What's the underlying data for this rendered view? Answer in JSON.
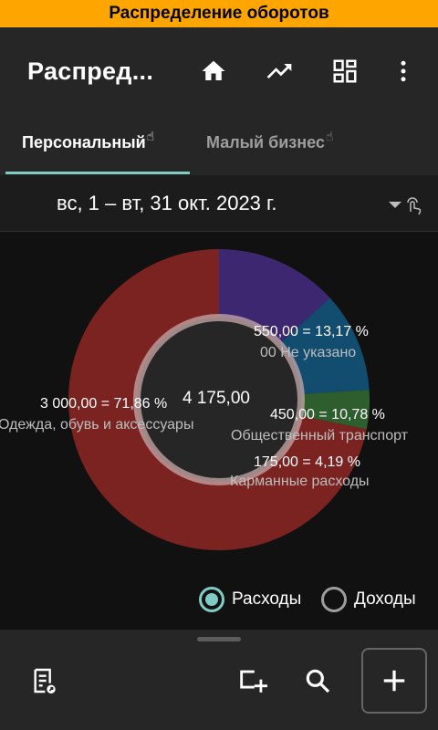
{
  "banner": {
    "title": "Распределение оборотов"
  },
  "appbar": {
    "title": "Распред...",
    "icons": [
      "home-icon",
      "trending-up-icon",
      "dashboard-icon",
      "more-vert-icon"
    ]
  },
  "tabs": [
    {
      "label": "Персональный",
      "selected": true,
      "sup": "☝"
    },
    {
      "label": "Малый бизнес",
      "selected": false,
      "sup": "☝"
    }
  ],
  "period": {
    "label": "вс, 1 – вт, 31 окт. 2023 г."
  },
  "chart_data": {
    "type": "pie",
    "donut": true,
    "total": "4 175,00",
    "slices": [
      {
        "name": "Одежда, обувь и аксессуары",
        "value": 3000.0,
        "value_label": "3 000,00 = 71,86 %",
        "color": "#7B2320"
      },
      {
        "name": "00 Не указано",
        "value": 550.0,
        "value_label": "550,00 = 13,17 %",
        "color": "#3D2770"
      },
      {
        "name": "Общественный транспорт",
        "value": 450.0,
        "value_label": "450,00 = 10,78 %",
        "color": "#124C6E"
      },
      {
        "name": "Карманные расходы",
        "value": 175.0,
        "value_label": "175,00 = 4,19 %",
        "color": "#2E5E2E"
      }
    ]
  },
  "filter": {
    "options": [
      {
        "label": "Расходы",
        "selected": true
      },
      {
        "label": "Доходы",
        "selected": false
      }
    ]
  },
  "bottombar": {
    "icons": [
      "report-icon",
      "add-account-icon",
      "search-icon",
      "add-icon"
    ]
  },
  "colors": {
    "accent": "#80CBC4",
    "banner": "#FFA500",
    "bar": "#262626"
  }
}
